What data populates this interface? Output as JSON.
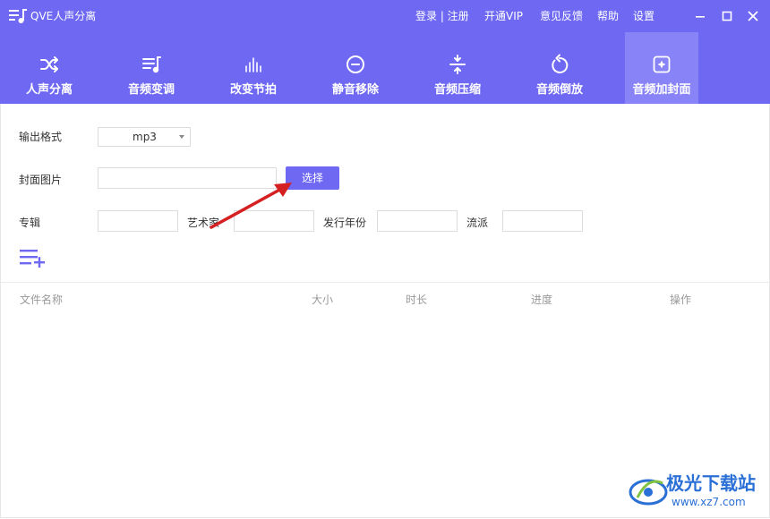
{
  "app": {
    "title": "QVE人声分离",
    "top_links": {
      "login_register": "登录 | 注册",
      "vip": "开通VIP",
      "feedback": "意见反馈",
      "help": "帮助",
      "settings": "设置"
    }
  },
  "toolbar": {
    "items": [
      {
        "label": "人声分离",
        "icon": "shuffle-icon"
      },
      {
        "label": "音频变调",
        "icon": "music-list-icon"
      },
      {
        "label": "改变节拍",
        "icon": "equalizer-icon"
      },
      {
        "label": "静音移除",
        "icon": "minus-circle-icon"
      },
      {
        "label": "音频压缩",
        "icon": "compress-icon"
      },
      {
        "label": "音频倒放",
        "icon": "rotate-icon"
      },
      {
        "label": "音频加封面",
        "icon": "image-sparkle-icon"
      }
    ],
    "active_index": 6
  },
  "form": {
    "output_format_label": "输出格式",
    "output_format_value": "mp3",
    "cover_label": "封面图片",
    "cover_value": "",
    "select_button": "选择",
    "album_label": "专辑",
    "artist_label": "艺术家",
    "year_label": "发行年份",
    "genre_label": "流派"
  },
  "table": {
    "columns": [
      "文件名称",
      "大小",
      "时长",
      "进度",
      "操作"
    ]
  },
  "watermark": {
    "name": "极光下载站",
    "url": "www.xz7.com"
  },
  "colors": {
    "accent": "#6e68f2",
    "active_tab": "#8883f6",
    "arrow": "#d42020"
  }
}
